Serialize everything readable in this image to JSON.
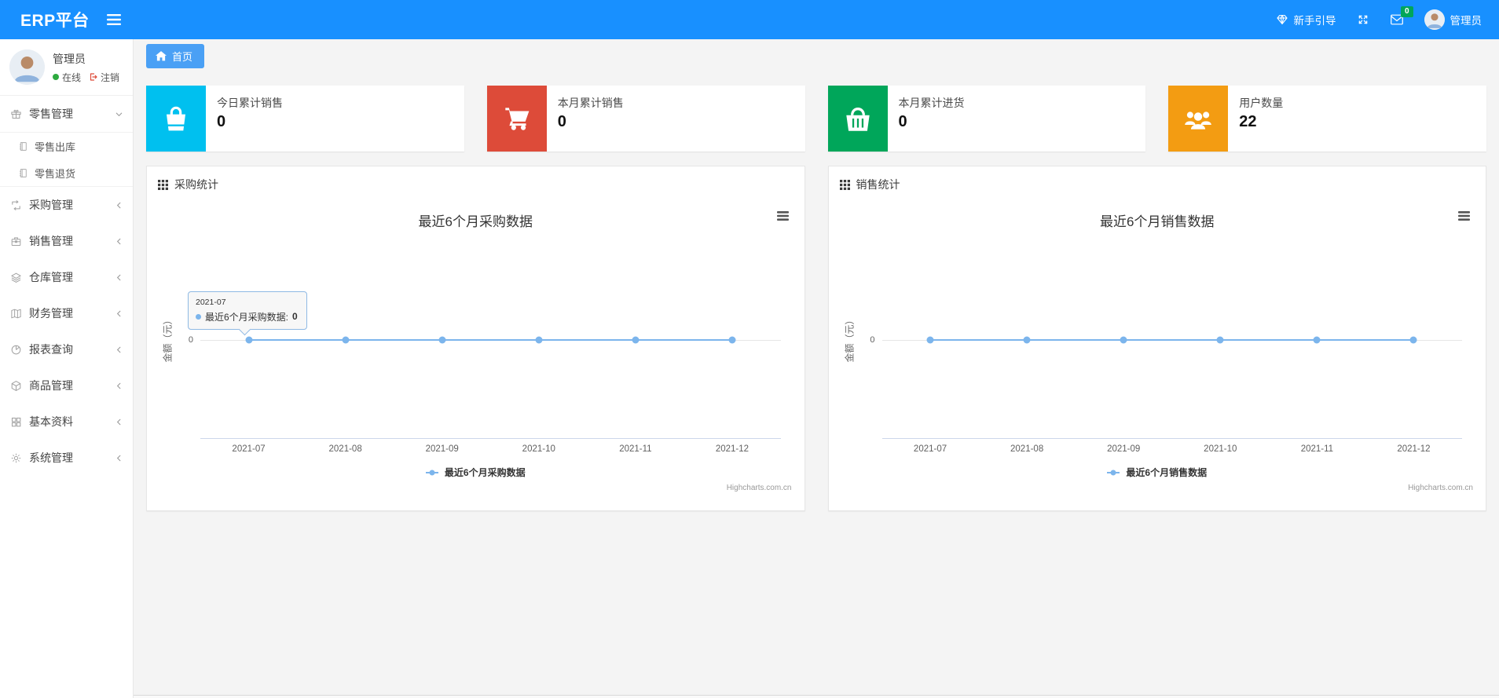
{
  "theme": {
    "navbar_blue": "#1890ff",
    "breadcrumb_tab_blue": "#4aa0f5",
    "badge_green": "#00a65a",
    "online_green": "#2daa3f",
    "logout_red": "#dd4b39"
  },
  "navbar": {
    "brand": "ERP平台",
    "guide_label": "新手引导",
    "messages_badge": "0",
    "username": "管理员"
  },
  "sidebar": {
    "user": {
      "name": "管理员",
      "status": "在线",
      "logout_label": "注销"
    },
    "items": [
      {
        "label": "零售管理",
        "icon": "gift-icon",
        "state": "expanded",
        "children": [
          {
            "label": "零售出库"
          },
          {
            "label": "零售退货"
          }
        ]
      },
      {
        "label": "采购管理",
        "icon": "loop-square-icon",
        "state": "collapsed"
      },
      {
        "label": "销售管理",
        "icon": "briefcase-icon",
        "state": "collapsed"
      },
      {
        "label": "仓库管理",
        "icon": "layers-icon",
        "state": "collapsed"
      },
      {
        "label": "财务管理",
        "icon": "map-book-icon",
        "state": "collapsed"
      },
      {
        "label": "报表查询",
        "icon": "pie-chart-icon",
        "state": "collapsed"
      },
      {
        "label": "商品管理",
        "icon": "cube-icon",
        "state": "collapsed"
      },
      {
        "label": "基本资料",
        "icon": "th-large-icon",
        "state": "collapsed"
      },
      {
        "label": "系统管理",
        "icon": "gear-icon",
        "state": "collapsed"
      }
    ]
  },
  "breadcrumb": {
    "home_label": "首页"
  },
  "stat_cards": [
    {
      "label": "今日累计销售",
      "value": "0",
      "color": "#00c0ef",
      "icon": "shopping-bag-icon"
    },
    {
      "label": "本月累计销售",
      "value": "0",
      "color": "#dd4b39",
      "icon": "shopping-cart-icon"
    },
    {
      "label": "本月累计进货",
      "value": "0",
      "color": "#00a65a",
      "icon": "shopping-basket-icon"
    },
    {
      "label": "用户数量",
      "value": "22",
      "color": "#f39c12",
      "icon": "users-icon"
    }
  ],
  "panels": [
    {
      "header": "采购统计"
    },
    {
      "header": "销售统计"
    }
  ],
  "chart_data": [
    {
      "type": "line",
      "title": "最近6个月采购数据",
      "categories": [
        "2021-07",
        "2021-08",
        "2021-09",
        "2021-10",
        "2021-11",
        "2021-12"
      ],
      "series": [
        {
          "name": "最近6个月采购数据",
          "values": [
            0,
            0,
            0,
            0,
            0,
            0
          ],
          "color": "#7cb5ec"
        }
      ],
      "ylabel": "金额（元）",
      "yticks": [
        "0"
      ],
      "ylim": [
        -1,
        1
      ],
      "grid": true,
      "legend_position": "bottom",
      "credits": "Highcharts.com.cn",
      "tooltip": {
        "x": "2021-07",
        "label": "最近6个月采购数据: ",
        "value": "0"
      }
    },
    {
      "type": "line",
      "title": "最近6个月销售数据",
      "categories": [
        "2021-07",
        "2021-08",
        "2021-09",
        "2021-10",
        "2021-11",
        "2021-12"
      ],
      "series": [
        {
          "name": "最近6个月销售数据",
          "values": [
            0,
            0,
            0,
            0,
            0,
            0
          ],
          "color": "#7cb5ec"
        }
      ],
      "ylabel": "金额（元）",
      "yticks": [
        "0"
      ],
      "ylim": [
        -1,
        1
      ],
      "grid": true,
      "legend_position": "bottom",
      "credits": "Highcharts.com.cn"
    }
  ]
}
